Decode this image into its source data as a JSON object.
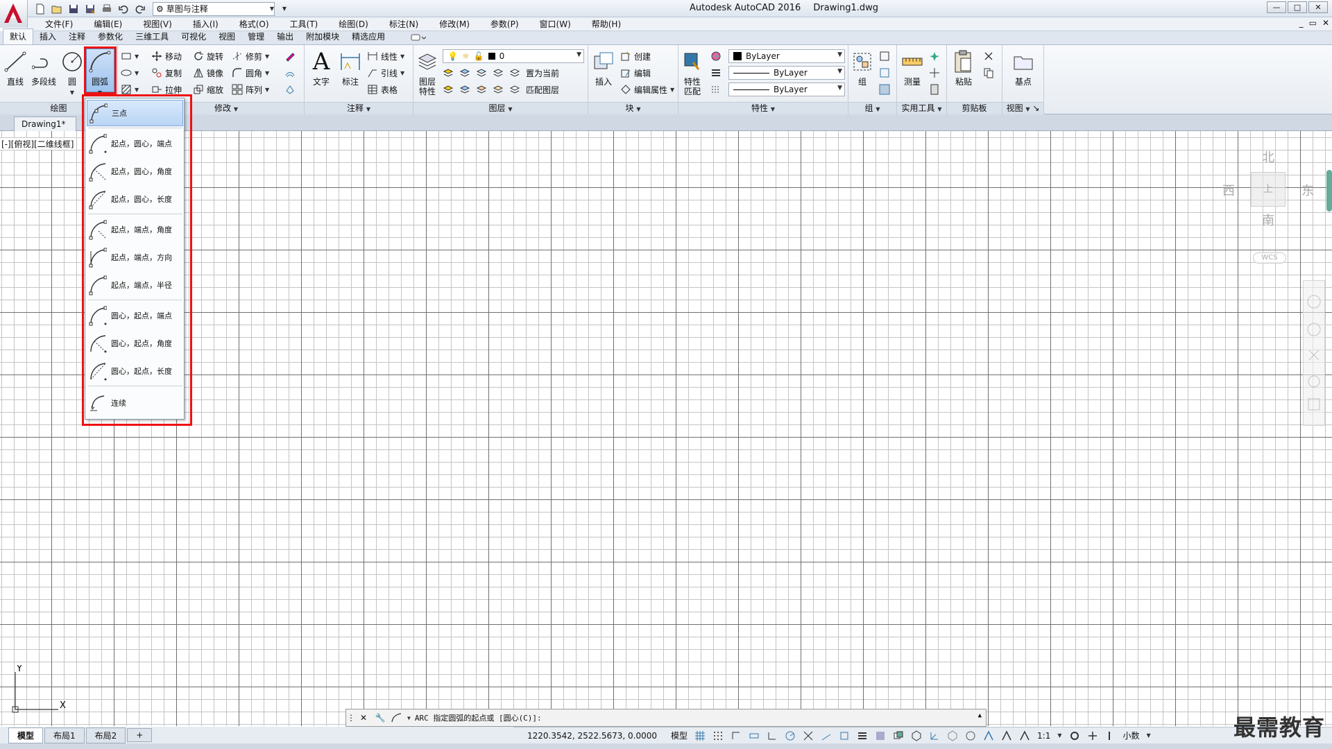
{
  "window": {
    "app_name": "Autodesk AutoCAD 2016",
    "file_name": "Drawing1.dwg",
    "controls": [
      "—",
      "□",
      "✕"
    ],
    "doc_controls": [
      "_",
      "▭",
      "✕"
    ]
  },
  "quick_access": {
    "workspace": "草图与注释"
  },
  "menus": [
    "文件(F)",
    "编辑(E)",
    "视图(V)",
    "插入(I)",
    "格式(O)",
    "工具(T)",
    "绘图(D)",
    "标注(N)",
    "修改(M)",
    "参数(P)",
    "窗口(W)",
    "帮助(H)"
  ],
  "ribbon_tabs": [
    "默认",
    "插入",
    "注释",
    "参数化",
    "三维工具",
    "可视化",
    "视图",
    "管理",
    "输出",
    "附加模块",
    "精选应用"
  ],
  "ribbon": {
    "draw": {
      "title": "绘图",
      "line": "直线",
      "polyline": "多段线",
      "circle": "圆",
      "arc": "圆弧"
    },
    "modify": {
      "title": "修改",
      "move": "移动",
      "rotate": "旋转",
      "trim": "修剪",
      "copy": "复制",
      "mirror": "镜像",
      "fillet": "圆角",
      "stretch": "拉伸",
      "scale": "缩放",
      "array": "阵列"
    },
    "annotation": {
      "title": "注释",
      "text": "文字",
      "dimension": "标注",
      "linear": "线性",
      "leader": "引线",
      "table": "表格"
    },
    "layers": {
      "title": "图层",
      "layer_props_line1": "图层",
      "layer_props_line2": "特性",
      "current_layer": "0",
      "set_current": "置为当前",
      "match_layer": "匹配图层"
    },
    "block": {
      "title": "块",
      "insert": "插入",
      "create": "创建",
      "edit": "编辑",
      "edit_attr": "编辑属性"
    },
    "properties": {
      "title": "特性",
      "match_line1": "特性",
      "match_line2": "匹配",
      "color": "ByLayer",
      "linetype": "ByLayer",
      "lineweight": "ByLayer"
    },
    "groups": {
      "title": "组",
      "group": "组"
    },
    "utilities": {
      "title": "实用工具",
      "measure": "测量"
    },
    "clipboard": {
      "title": "剪贴板",
      "paste": "粘贴"
    },
    "view": {
      "title": "视图",
      "base": "基点"
    }
  },
  "file_tab": "Drawing1*",
  "viewport_label": "[-][俯视][二维线框]",
  "viewcube": {
    "north": "北",
    "south": "南",
    "east": "东",
    "west": "西",
    "top": "上",
    "wcs": "WCS"
  },
  "ucs": {
    "x": "X",
    "y": "Y"
  },
  "arc_menu": {
    "items": [
      {
        "label": "三点",
        "selected": true
      },
      {
        "label": "起点，圆心，端点"
      },
      {
        "label": "起点，圆心，角度"
      },
      {
        "label": "起点，圆心，长度"
      },
      {
        "label": "起点，端点，角度"
      },
      {
        "label": "起点，端点，方向"
      },
      {
        "label": "起点，端点，半径"
      },
      {
        "label": "圆心，起点，端点"
      },
      {
        "label": "圆心，起点，角度"
      },
      {
        "label": "圆心，起点，长度"
      },
      {
        "label": "连续"
      }
    ]
  },
  "command_line": {
    "text": "ARC 指定圆弧的起点或 [圆心(C)]:"
  },
  "layout_tabs": [
    "模型",
    "布局1",
    "布局2",
    "+"
  ],
  "status": {
    "coords": "1220.3542, 2522.5673, 0.0000",
    "model": "模型",
    "scale": "1:1",
    "units": "小数"
  },
  "watermark": "最需教育",
  "colors": {
    "accent": "#3b78c8",
    "highlight": "#e11111",
    "logo_red": "#c8102e"
  }
}
